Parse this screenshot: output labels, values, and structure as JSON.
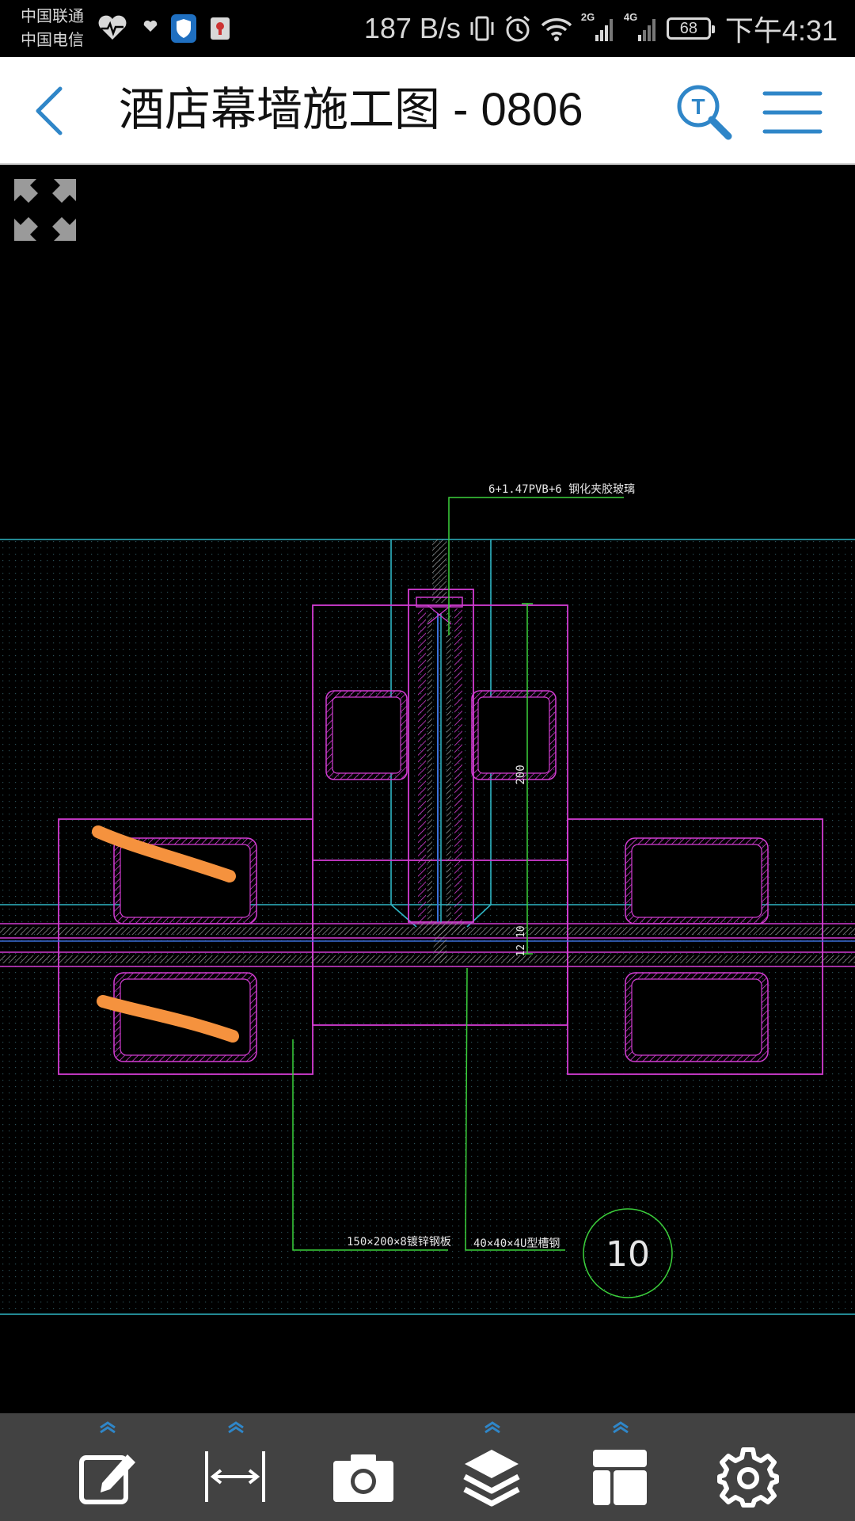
{
  "status_bar": {
    "carrier_1": "中国联通",
    "carrier_2": "中国电信",
    "net_speed": "187 B/s",
    "network_1": "2G",
    "network_2": "4G",
    "battery": "68",
    "time": "下午4:31"
  },
  "header": {
    "title": "酒店幕墙施工图 - 0806"
  },
  "drawing": {
    "label_glass": "6+1.47PVB+6 钢化夹胶玻璃",
    "dim_200": "200",
    "dim_12": "12 10",
    "label_plate": "150×200×8镀锌钢板",
    "label_channel": "40×40×4U型槽钢",
    "detail_number": "10"
  },
  "colors": {
    "accent": "#2f86c8",
    "toolbar_bg": "#424242",
    "cad_magenta": "#d23cd2",
    "cad_cyan": "#2fb5c4",
    "cad_green": "#3cd23c",
    "markup_orange": "#f5923e"
  },
  "toolbar": {
    "items": [
      "edit-icon",
      "measure-icon",
      "camera-icon",
      "layers-icon",
      "layout-icon",
      "settings-icon"
    ]
  }
}
